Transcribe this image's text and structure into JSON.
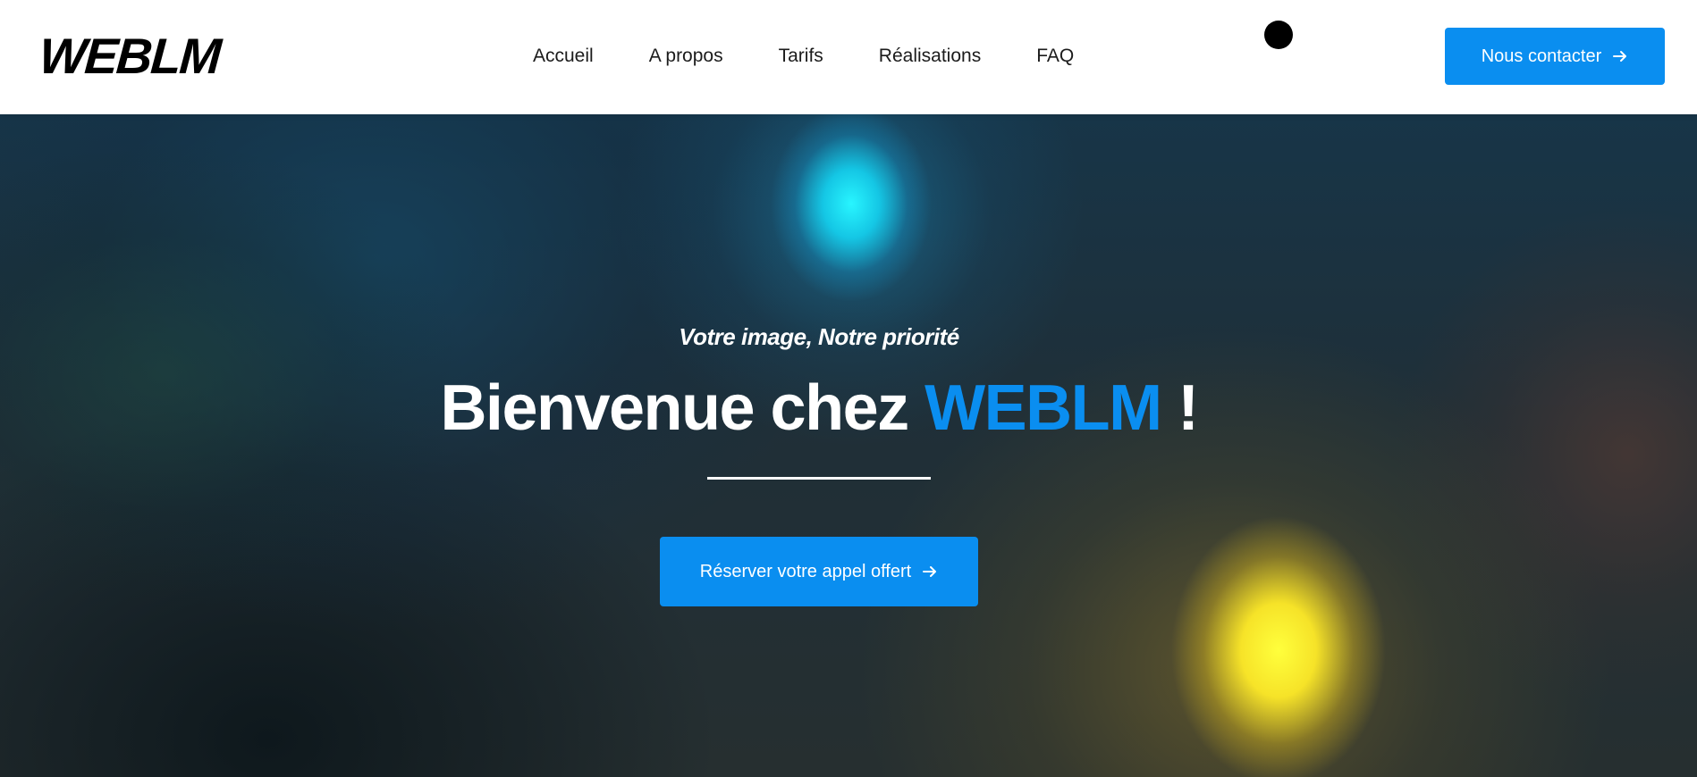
{
  "header": {
    "logo_text": "WEBLM",
    "nav": [
      {
        "label": "Accueil"
      },
      {
        "label": "A propos"
      },
      {
        "label": "Tarifs"
      },
      {
        "label": "Réalisations"
      },
      {
        "label": "FAQ"
      }
    ],
    "contact_button": {
      "label": "Nous contacter",
      "icon": "arrow-right-icon"
    }
  },
  "hero": {
    "tagline": "Votre image, Notre priorité",
    "title_prefix": "Bienvenue chez ",
    "title_brand": "WEBLM",
    "title_suffix": " !",
    "cta_button": {
      "label": "Réserver votre appel offert",
      "icon": "arrow-right-icon"
    }
  },
  "colors": {
    "accent": "#0a8ef0",
    "header_bg": "#ffffff",
    "text_dark": "#1b1b1b",
    "hero_text": "#ffffff",
    "glow_cyan": "#28f5ff",
    "glow_yellow": "#ffff3c"
  }
}
